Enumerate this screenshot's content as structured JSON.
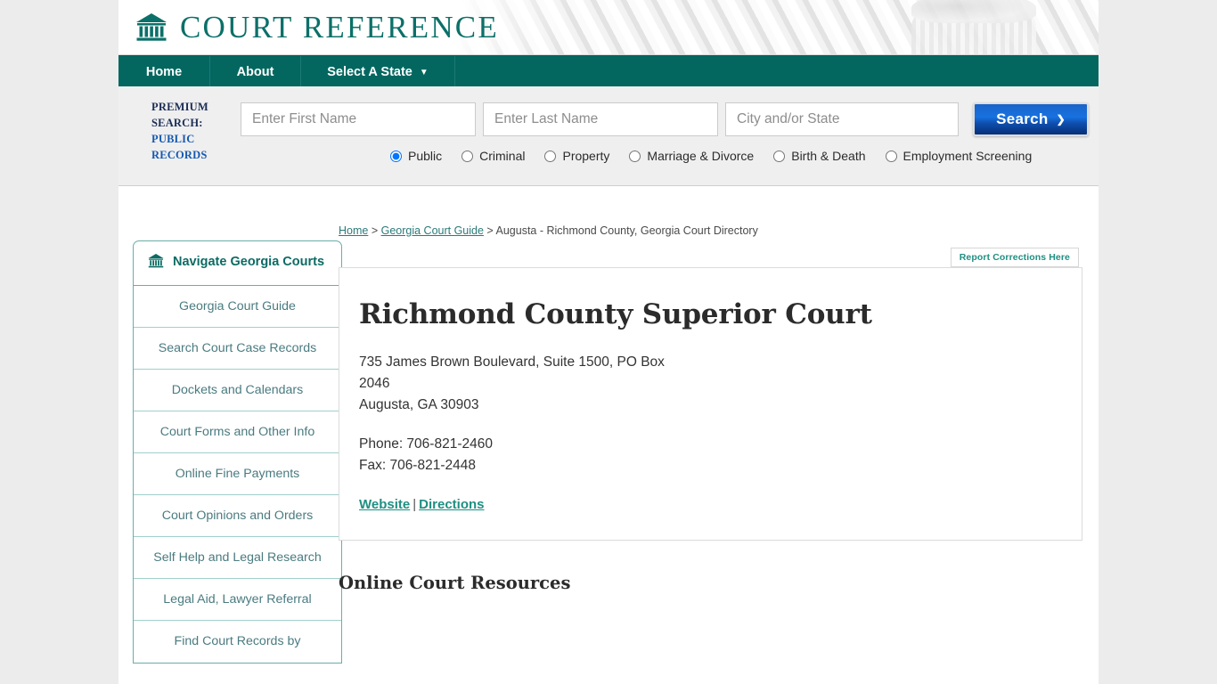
{
  "brand": {
    "name": "COURT REFERENCE",
    "icon": "courthouse-icon"
  },
  "nav": {
    "items": [
      {
        "label": "Home",
        "name": "nav-home"
      },
      {
        "label": "About",
        "name": "nav-about"
      },
      {
        "label": "Select A State",
        "name": "nav-select-a-state",
        "caret": "▼"
      }
    ]
  },
  "premium_search": {
    "label_line1": "PREMIUM",
    "label_line2": "SEARCH:",
    "label_line3": "PUBLIC",
    "label_line4": "RECORDS",
    "first_name_placeholder": "Enter First Name",
    "first_name_value": "",
    "last_name_placeholder": "Enter Last Name",
    "last_name_value": "",
    "city_state_placeholder": "City and/or State",
    "city_state_value": "",
    "search_button": "Search",
    "search_chevron": "❯",
    "radios": [
      {
        "label": "Public",
        "checked": true
      },
      {
        "label": "Criminal",
        "checked": false
      },
      {
        "label": "Property",
        "checked": false
      },
      {
        "label": "Marriage & Divorce",
        "checked": false
      },
      {
        "label": "Birth & Death",
        "checked": false
      },
      {
        "label": "Employment Screening",
        "checked": false
      }
    ]
  },
  "breadcrumb": {
    "home": "Home",
    "sep1": " > ",
    "guide": "Georgia Court Guide",
    "sep2": " > ",
    "current": "Augusta - Richmond County, Georgia Court Directory"
  },
  "report_corrections": "Report Corrections Here",
  "sidebar": {
    "heading": "Navigate Georgia Courts",
    "heading_icon": "courthouse-icon",
    "items": [
      {
        "label": "Georgia Court Guide"
      },
      {
        "label": "Search Court Case Records"
      },
      {
        "label": "Dockets and Calendars"
      },
      {
        "label": "Court Forms and Other Info"
      },
      {
        "label": "Online Fine Payments"
      },
      {
        "label": "Court Opinions and Orders"
      },
      {
        "label": "Self Help and Legal Research"
      },
      {
        "label": "Legal Aid, Lawyer Referral"
      },
      {
        "label": "Find Court Records by"
      }
    ]
  },
  "court": {
    "title": "Richmond County Superior Court",
    "address_line1": "735 James Brown Boulevard, Suite 1500, PO Box 2046",
    "address_line2": "Augusta, GA 30903",
    "phone": "Phone: 706-821-2460",
    "fax": "Fax: 706-821-2448",
    "website_link": "Website",
    "links_separator": "|",
    "directions_link": "Directions"
  },
  "sections": {
    "online_court_resources": "Online Court Resources"
  },
  "colors": {
    "teal": "#036760",
    "brand_teal": "#0b7069",
    "link_teal": "#1f8f82",
    "premium_navy": "#1b2d55",
    "premium_blue": "#1559b0",
    "search_blue": "#1772e0"
  }
}
